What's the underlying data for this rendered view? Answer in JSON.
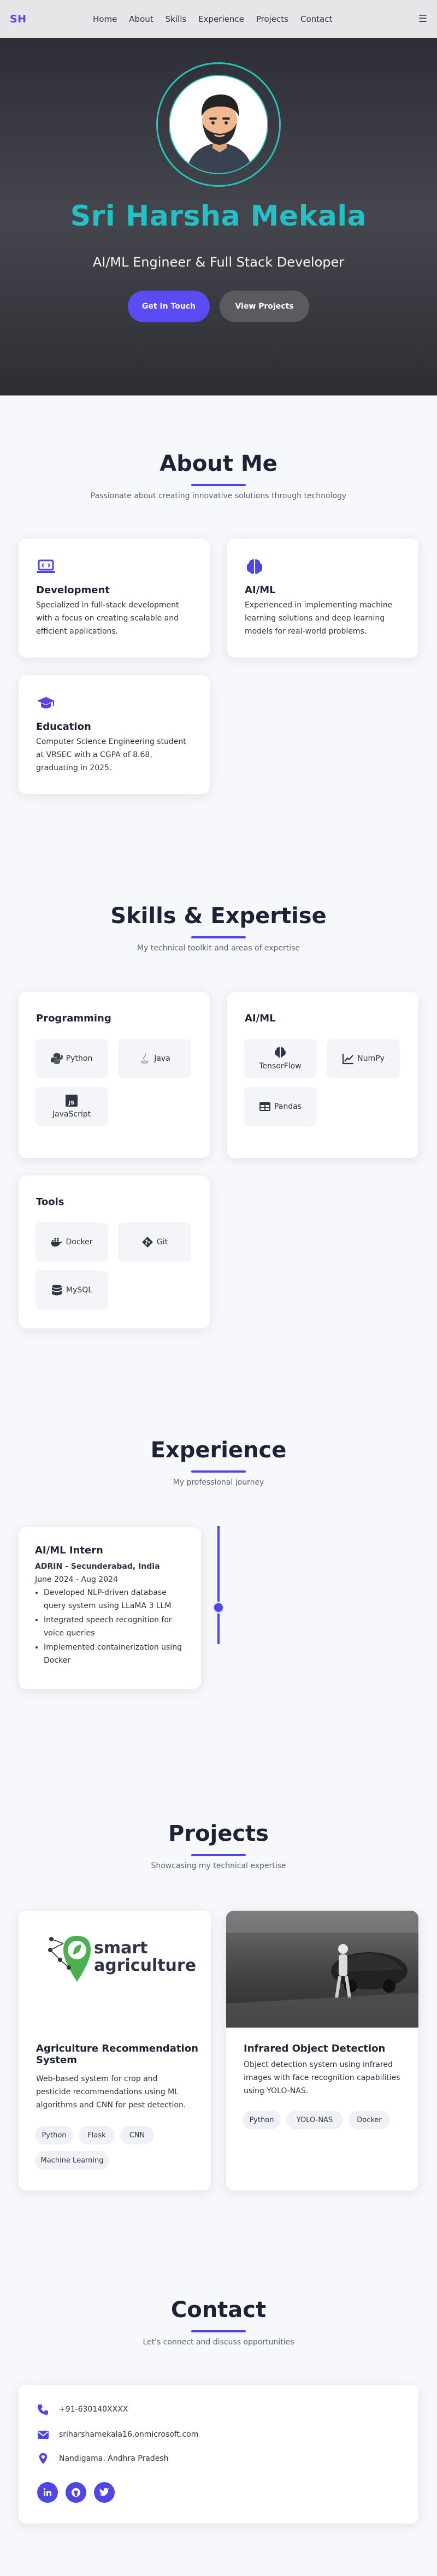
{
  "nav": {
    "logo": "SH",
    "links": [
      "Home",
      "About",
      "Skills",
      "Experience",
      "Projects",
      "Contact"
    ],
    "menu_icon": "hamburger-icon"
  },
  "hero": {
    "name": "Sri Harsha Mekala",
    "subtitle": "AI/ML Engineer & Full Stack Developer",
    "primary_button": "Get In Touch",
    "secondary_button": "View Projects",
    "accent_color": "#23c1c6"
  },
  "about": {
    "title": "About Me",
    "subtitle": "Passionate about creating innovative solutions through technology",
    "cards": [
      {
        "icon": "laptop-code-icon",
        "title": "Development",
        "text": [
          "Specialized in full-stack development",
          "with a focus on creating scalable and",
          "efficient applications."
        ]
      },
      {
        "icon": "brain-icon",
        "title": "AI/ML",
        "text": [
          "Experienced in implementing machine",
          "learning solutions and deep learning",
          "models for real-world problems."
        ]
      },
      {
        "icon": "graduation-cap-icon",
        "title": "Education",
        "text": [
          "Computer Science Engineering student",
          "at VRSEC with a CGPA of 8.68,",
          "graduating in 2025."
        ]
      }
    ]
  },
  "skills": {
    "title": "Skills & Expertise",
    "subtitle": "My technical toolkit and areas of expertise",
    "groups": [
      {
        "title": "Programming",
        "items": [
          {
            "name": "Python",
            "icon": "python-icon"
          },
          {
            "name": "Java",
            "icon": "java-icon"
          },
          {
            "name": "JavaScript",
            "icon": "javascript-icon"
          }
        ]
      },
      {
        "title": "AI/ML",
        "items": [
          {
            "name": "TensorFlow",
            "icon": "brain-icon"
          },
          {
            "name": "NumPy",
            "icon": "chart-line-icon"
          },
          {
            "name": "Pandas",
            "icon": "table-icon"
          }
        ]
      },
      {
        "title": "Tools",
        "items": [
          {
            "name": "Docker",
            "icon": "docker-icon"
          },
          {
            "name": "Git",
            "icon": "git-icon"
          },
          {
            "name": "MySQL",
            "icon": "database-icon"
          }
        ]
      }
    ]
  },
  "experience": {
    "title": "Experience",
    "subtitle": "My professional journey",
    "items": [
      {
        "role": "AI/ML Intern",
        "company": "ADRIN - Secunderabad, India",
        "dates": "June 2024 - Aug 2024",
        "bullets": [
          "Developed NLP-driven database query system using LLaMA 3 LLM",
          "Integrated speech recognition for voice queries",
          "Implemented containerization using Docker"
        ]
      }
    ]
  },
  "projects": {
    "title": "Projects",
    "subtitle": "Showcasing my technical expertise",
    "items": [
      {
        "title_lines": [
          "Agriculture Recommendation",
          "System"
        ],
        "desc": [
          "Web-based system for crop and",
          "pesticide recommendations using ML",
          "algorithms and CNN for pest detection."
        ],
        "tags": [
          "Python",
          "Flask",
          "CNN",
          "Machine Learning"
        ],
        "logo_text_1": "smart",
        "logo_text_2": "agriculture"
      },
      {
        "title_lines": [
          "Infrared Object Detection"
        ],
        "desc": [
          "Object detection system using infrared",
          "images with face recognition capabilities",
          "using YOLO-NAS."
        ],
        "tags": [
          "Python",
          "YOLO-NAS",
          "Docker"
        ]
      }
    ]
  },
  "contact": {
    "title": "Contact",
    "subtitle": "Let's connect and discuss opportunities",
    "phone": "+91-630140XXXX",
    "email": "sriharshamekala16.onmicrosoft.com",
    "location": "Nandigama, Andhra Pradesh",
    "socials": [
      "linkedin-icon",
      "github-icon",
      "twitter-icon"
    ],
    "accent_color": "#4f46e5"
  }
}
